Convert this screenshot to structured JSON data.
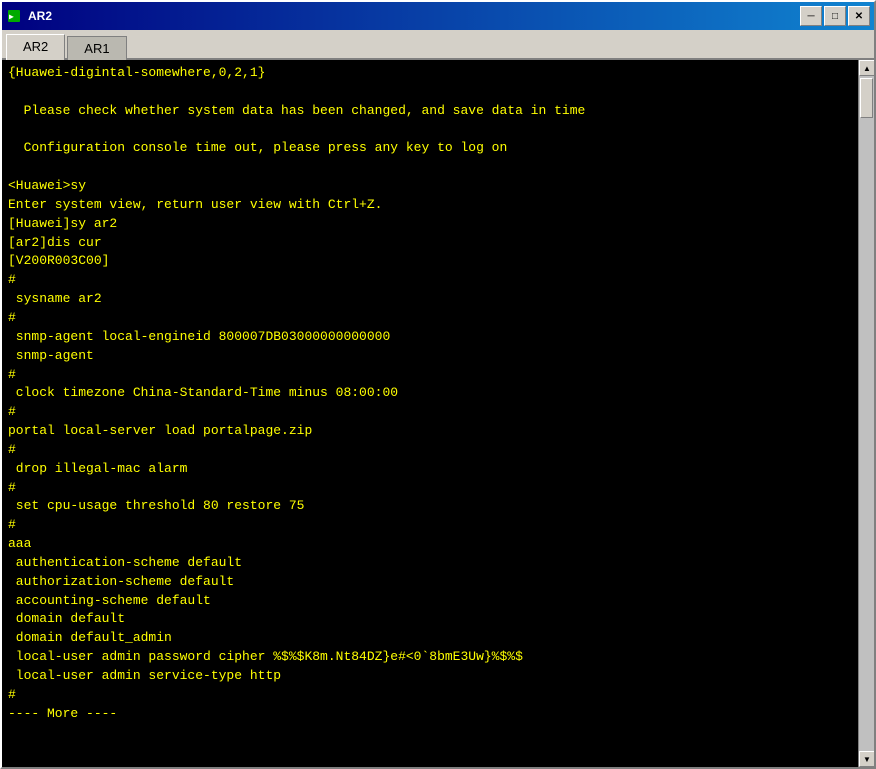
{
  "window": {
    "title": "AR2",
    "icon": "terminal-icon"
  },
  "titleButtons": {
    "minimize": "─",
    "maximize": "□",
    "close": "✕"
  },
  "tabs": [
    {
      "id": "ar2",
      "label": "AR2",
      "active": true
    },
    {
      "id": "ar1",
      "label": "AR1",
      "active": false
    }
  ],
  "terminal": {
    "lines": [
      "{Huawei-digintal-somewhere,0,2,1}",
      "",
      "  Please check whether system data has been changed, and save data in time",
      "",
      "  Configuration console time out, please press any key to log on",
      "",
      "<Huawei>sy",
      "Enter system view, return user view with Ctrl+Z.",
      "[Huawei]sy ar2",
      "[ar2]dis cur",
      "[V200R003C00]",
      "#",
      " sysname ar2",
      "#",
      " snmp-agent local-engineid 800007DB03000000000000",
      " snmp-agent",
      "#",
      " clock timezone China-Standard-Time minus 08:00:00",
      "#",
      "portal local-server load portalpage.zip",
      "#",
      " drop illegal-mac alarm",
      "#",
      " set cpu-usage threshold 80 restore 75",
      "#",
      "aaa",
      " authentication-scheme default",
      " authorization-scheme default",
      " accounting-scheme default",
      " domain default",
      " domain default_admin",
      " local-user admin password cipher %$%$K8m.Nt84DZ}e#<0`8bmE3Uw}%$%$",
      " local-user admin service-type http",
      "#",
      "---- More ----"
    ]
  }
}
